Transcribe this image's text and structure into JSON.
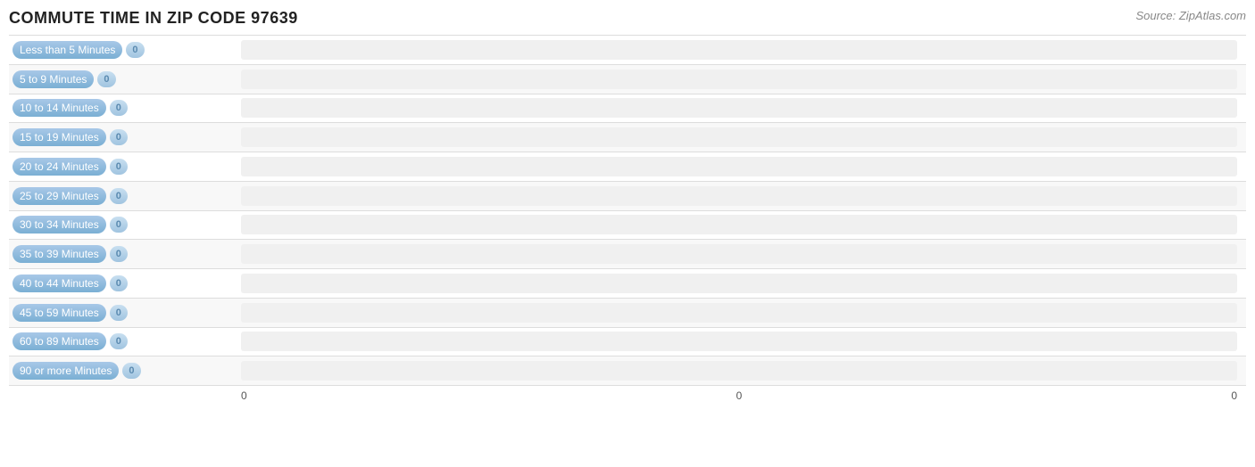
{
  "header": {
    "title": "COMMUTE TIME IN ZIP CODE 97639",
    "source": "Source: ZipAtlas.com"
  },
  "bars": [
    {
      "label": "Less than 5 Minutes",
      "value": "0"
    },
    {
      "label": "5 to 9 Minutes",
      "value": "0"
    },
    {
      "label": "10 to 14 Minutes",
      "value": "0"
    },
    {
      "label": "15 to 19 Minutes",
      "value": "0"
    },
    {
      "label": "20 to 24 Minutes",
      "value": "0"
    },
    {
      "label": "25 to 29 Minutes",
      "value": "0"
    },
    {
      "label": "30 to 34 Minutes",
      "value": "0"
    },
    {
      "label": "35 to 39 Minutes",
      "value": "0"
    },
    {
      "label": "40 to 44 Minutes",
      "value": "0"
    },
    {
      "label": "45 to 59 Minutes",
      "value": "0"
    },
    {
      "label": "60 to 89 Minutes",
      "value": "0"
    },
    {
      "label": "90 or more Minutes",
      "value": "0"
    }
  ],
  "xaxis": {
    "labels": [
      "0",
      "0",
      "0"
    ]
  }
}
